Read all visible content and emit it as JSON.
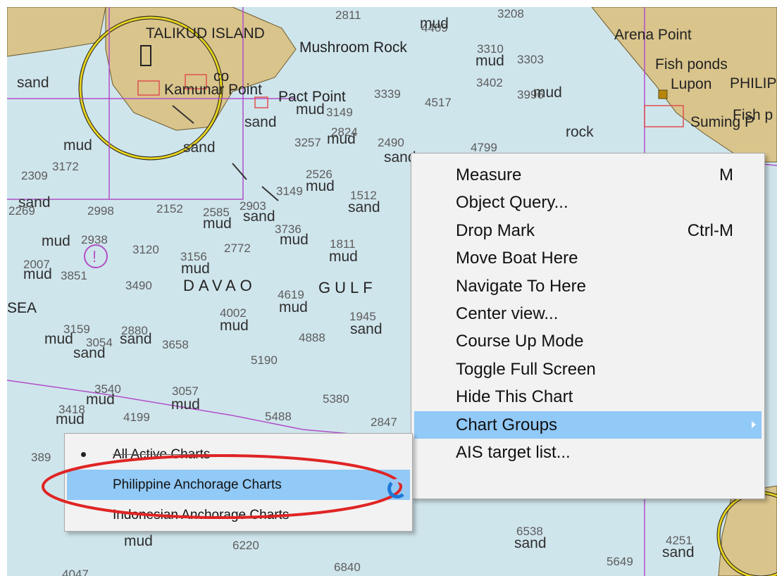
{
  "chart": {
    "places": {
      "taliku": "TALIKUD ISLAND",
      "mushroom": "Mushroom Rock",
      "arena": "Arena Point",
      "fishponds": "Fish ponds",
      "lupon": "Lupon",
      "philip": "PHILIP",
      "kamunar": "Kamunar Point",
      "pact": "Pact Point",
      "suming": "Suming P",
      "fishp": "Fish p",
      "davao": "DAVAO",
      "gulf": "GULF",
      "sea": "SEA",
      "co": "co"
    },
    "depths": [
      "4409",
      "3208",
      "2811",
      "3310",
      "3303",
      "3402",
      "3339",
      "4517",
      "3996",
      "3149",
      "2824",
      "3257",
      "2490",
      "4799",
      "2309",
      "3172",
      "2526",
      "3149",
      "1512",
      "2269",
      "2998",
      "2152",
      "2585",
      "2903",
      "3736",
      "2938",
      "3120",
      "3156",
      "2772",
      "1811",
      "2007",
      "3851",
      "3490",
      "4619",
      "1945",
      "4002",
      "3159",
      "3054",
      "2880",
      "3658",
      "4888",
      "5190",
      "3540",
      "3057",
      "5380",
      "3418",
      "4199",
      "5488",
      "2847",
      "389",
      "6220",
      "6538",
      "4251",
      "5649",
      "6840",
      "4047"
    ],
    "seabed": [
      "mud",
      "sand",
      "rock"
    ]
  },
  "context_menu": {
    "items": [
      {
        "label": "Measure",
        "shortcut": "M"
      },
      {
        "label": "Object Query...",
        "shortcut": ""
      },
      {
        "label": "Drop Mark",
        "shortcut": "Ctrl-M"
      },
      {
        "label": "Move Boat Here",
        "shortcut": ""
      },
      {
        "label": "Navigate To Here",
        "shortcut": ""
      },
      {
        "label": "Center view...",
        "shortcut": ""
      },
      {
        "label": "Course Up Mode",
        "shortcut": ""
      },
      {
        "label": "Toggle Full Screen",
        "shortcut": ""
      },
      {
        "label": "Hide This Chart",
        "shortcut": ""
      },
      {
        "label": "Chart Groups",
        "shortcut": ""
      },
      {
        "label": "AIS target list...",
        "shortcut": ""
      }
    ]
  },
  "submenu": {
    "items": [
      {
        "label": "All Active Charts"
      },
      {
        "label": "Philippine Anchorage Charts"
      },
      {
        "label": "Indonesian Anchorage Charts"
      }
    ]
  },
  "colors": {
    "sea": "#cfe5ec",
    "land": "#d9c48c",
    "menu_bg": "#f2f2f2",
    "highlight": "#91c9f7",
    "annotation_red": "#e02424",
    "boundary_magenta": "#b04fc8"
  }
}
